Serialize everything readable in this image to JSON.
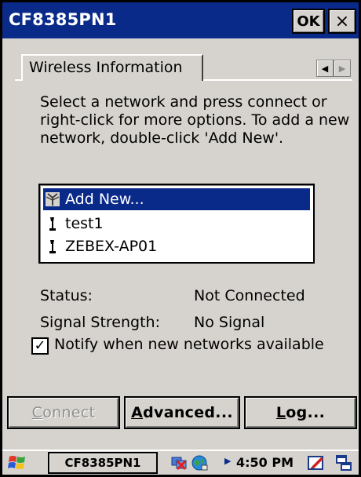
{
  "window": {
    "title": "CF8385PN1",
    "ok_label": "OK",
    "close_label": "×"
  },
  "tabs": {
    "active_label": "Wireless Information",
    "scroll_left": "◀",
    "scroll_right": "▶"
  },
  "instructions": "Select a network and press connect or right-click for more options.  To add a new network, double-click 'Add New'.",
  "networks": [
    {
      "label": "Add New...",
      "selected": true,
      "icon": "antenna-icon"
    },
    {
      "label": "test1",
      "selected": false,
      "icon": "access-point-icon"
    },
    {
      "label": "ZEBEX-AP01",
      "selected": false,
      "icon": "access-point-icon"
    }
  ],
  "status": {
    "status_label": "Status:",
    "status_value": "Not Connected",
    "signal_label": "Signal Strength:",
    "signal_value": "No Signal"
  },
  "notify": {
    "label": "Notify when new networks available",
    "checked": true,
    "check_mark": "✓"
  },
  "buttons": {
    "connect_first": "C",
    "connect_rest": "onnect",
    "advanced_first": "A",
    "advanced_rest": "dvanced...",
    "log_first": "L",
    "log_rest": "og..."
  },
  "taskbar": {
    "task_label": "CF8385PN1",
    "time": "4:50 PM"
  },
  "colors": {
    "title_bar": "#0a2a8a",
    "selection": "#0a2a8a",
    "dialog_bg": "#d6d3ce"
  }
}
